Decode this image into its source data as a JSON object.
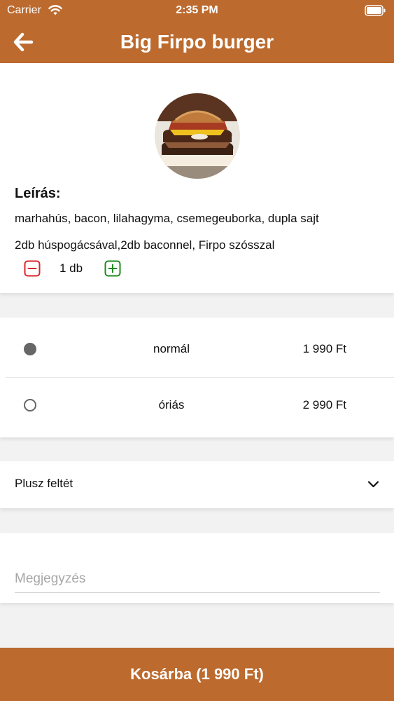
{
  "status_bar": {
    "carrier": "Carrier",
    "time": "2:35 PM",
    "icons": [
      "wifi-icon",
      "battery-icon"
    ]
  },
  "header": {
    "title": "Big Firpo burger",
    "back_icon": "back-arrow-icon",
    "background_color": "#bc6a2e"
  },
  "product": {
    "description_label": "Leírás:",
    "description_line1": "marhahús, bacon, lilahagyma, csemegeuborka, dupla sajt",
    "description_line2": "2db húspogácsával,2db baconnel, Firpo szósszal",
    "quantity_text": "1 db",
    "minus_color": "#d9262c",
    "plus_color": "#1f8b1f"
  },
  "sizes": [
    {
      "name": "normál",
      "price": "1 990 Ft",
      "selected": true
    },
    {
      "name": "óriás",
      "price": "2 990 Ft",
      "selected": false
    }
  ],
  "extras": {
    "label": "Plusz feltét",
    "icon": "chevron-down-icon"
  },
  "note": {
    "placeholder": "Megjegyzés",
    "value": ""
  },
  "cart_button": {
    "label": "Kosárba (1 990 Ft)"
  }
}
